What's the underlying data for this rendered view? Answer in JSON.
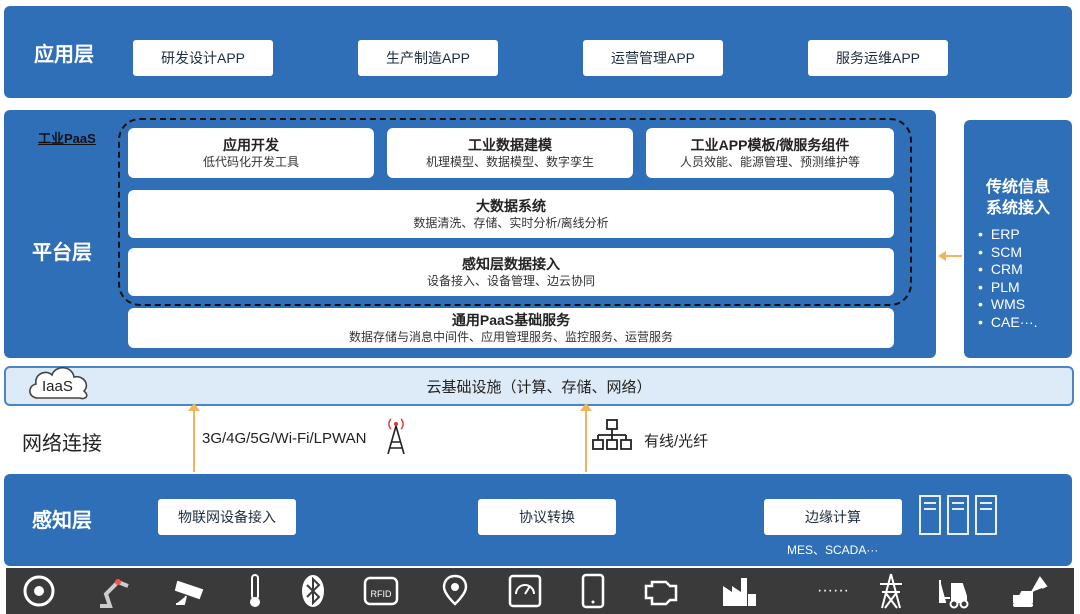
{
  "app_layer": {
    "title": "应用层",
    "apps": [
      "研发设计APP",
      "生产制造APP",
      "运营管理APP",
      "服务运维APP"
    ]
  },
  "platform_layer": {
    "title": "平台层",
    "paas_label": "工业PaaS",
    "modules": [
      {
        "title": "应用开发",
        "subtitle": "低代码化开发工具"
      },
      {
        "title": "工业数据建模",
        "subtitle": "机理模型、数据模型、数字孪生"
      },
      {
        "title": "工业APP模板/微服务组件",
        "subtitle": "人员效能、能源管理、预测维护等"
      }
    ],
    "big_data": {
      "title": "大数据系统",
      "subtitle": "数据清洗、存储、实时分析/离线分析"
    },
    "sensing_access": {
      "title": "感知层数据接入",
      "subtitle": "设备接入、设备管理、边云协同"
    },
    "general_paas": {
      "title": "通用PaaS基础服务",
      "subtitle": "数据存储与消息中间件、应用管理服务、监控服务、运营服务"
    }
  },
  "legacy": {
    "title_line1": "传统信息",
    "title_line2": "系统接入",
    "items": [
      "ERP",
      "SCM",
      "CRM",
      "PLM",
      "WMS",
      "CAE···."
    ]
  },
  "iaas": {
    "label": "IaaS",
    "text": "云基础设施（计算、存储、网络）"
  },
  "network": {
    "title": "网络连接",
    "wireless": "3G/4G/5G/Wi-Fi/LPWAN",
    "wired": "有线/光纤"
  },
  "sensing_layer": {
    "title": "感知层",
    "items": [
      "物联网设备接入",
      "协议转换",
      "边缘计算"
    ],
    "edge_note": "MES、SCADA···"
  },
  "icon_strip": [
    "turbine-icon",
    "robot-arm-icon",
    "camera-icon",
    "thermometer-icon",
    "bluetooth-icon",
    "rfid-icon",
    "location-pin-icon",
    "meter-icon",
    "tablet-icon",
    "engine-icon",
    "factory-icon",
    "more-icon",
    "power-tower-icon",
    "forklift-icon",
    "excavator-icon"
  ],
  "icon_more_text": "······",
  "colors": {
    "band": "#2f6fb8",
    "iaas_fill": "#ddeaf7",
    "arrow": "#f2b35a"
  }
}
